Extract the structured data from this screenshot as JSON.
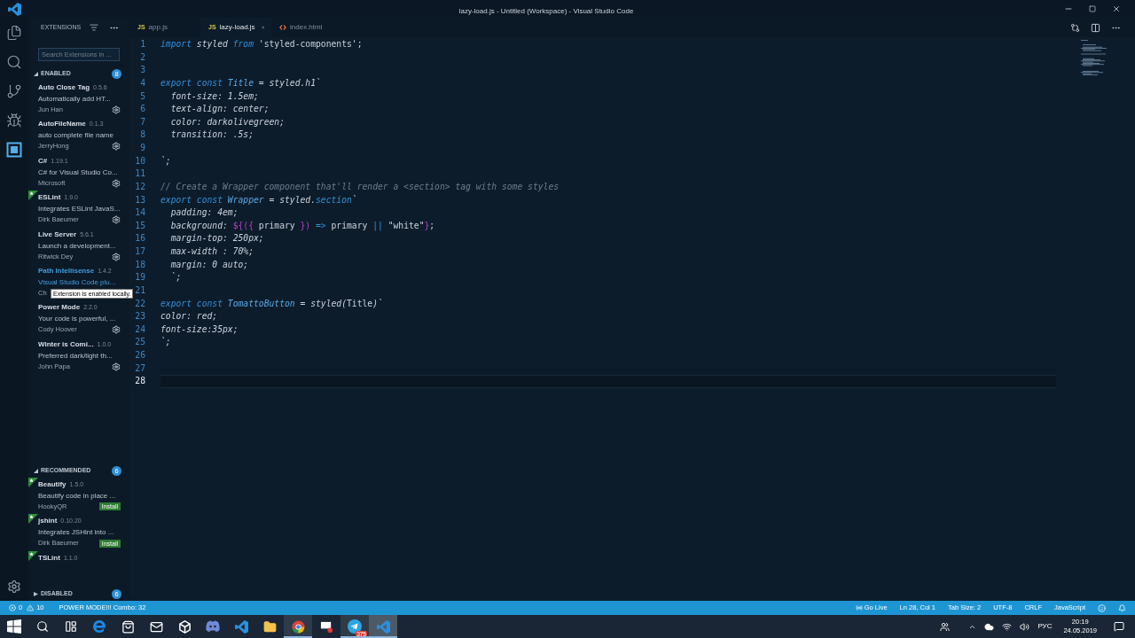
{
  "window": {
    "title": "lazy-load.js - Untitled (Workspace) - Visual Studio Code"
  },
  "activity_bar": [
    {
      "kind": "files",
      "selected": false
    },
    {
      "kind": "search",
      "selected": false
    },
    {
      "kind": "source-control",
      "selected": false
    },
    {
      "kind": "debug",
      "selected": false
    },
    {
      "kind": "extensions",
      "selected": true
    }
  ],
  "sidebar": {
    "title": "EXTENSIONS",
    "search": {
      "placeholder": "Search Extensions in ..."
    },
    "sections": [
      {
        "title": "ENABLED",
        "count": "8",
        "expanded": true,
        "items": [
          {
            "name": "Auto Close Tag",
            "version": "0.5.6",
            "description": "Automatically add HT...",
            "author": "Jun Han",
            "starred": false,
            "selected": false,
            "kind": "gear"
          },
          {
            "name": "AutoFileName",
            "version": "0.1.3",
            "description": "auto complete file name",
            "author": "JerryHong",
            "starred": false,
            "selected": false,
            "kind": "gear"
          },
          {
            "name": "C#",
            "version": "1.19.1",
            "description": "C# for Visual Studio Co...",
            "author": "Microsoft",
            "starred": false,
            "selected": false,
            "kind": "gear"
          },
          {
            "name": "ESLint",
            "version": "1.9.0",
            "description": "Integrates ESLint JavaS...",
            "author": "Dirk Baeumer",
            "starred": true,
            "selected": false,
            "kind": "gear"
          },
          {
            "name": "Live Server",
            "version": "5.6.1",
            "description": "Launch a development...",
            "author": "Ritwick Dey",
            "starred": false,
            "selected": false,
            "kind": "gear"
          },
          {
            "name": "Path Intellisense",
            "version": "1.4.2",
            "description": "Visual Studio Code plu...",
            "author": "Ch",
            "starred": false,
            "selected": true,
            "kind": "plain",
            "tooltip": "Extension is enabled locally."
          },
          {
            "name": "Power Mode",
            "version": "2.2.0",
            "description": "Your code is powerful, ...",
            "author": "Cody Hoover",
            "starred": false,
            "selected": false,
            "kind": "gear"
          },
          {
            "name": "Winter is Comi...",
            "version": "1.0.0",
            "description": "Preferred dark/light th...",
            "author": "John Papa",
            "starred": false,
            "selected": false,
            "kind": "gear"
          }
        ]
      },
      {
        "title": "RECOMMENDED",
        "count": "6",
        "expanded": true,
        "items": [
          {
            "name": "Beautify",
            "version": "1.5.0",
            "description": "Beautify code in place ...",
            "author": "HookyQR",
            "starred": true,
            "selected": false,
            "kind": "install",
            "action_label": "Install"
          },
          {
            "name": "jshint",
            "version": "0.10.20",
            "description": "Integrates JSHint into ...",
            "author": "Dirk Baeumer",
            "starred": true,
            "selected": false,
            "kind": "install",
            "action_label": "Install"
          },
          {
            "name": "TSLint",
            "version": "1.1.0",
            "starred": true,
            "selected": false
          }
        ]
      },
      {
        "title": "DISABLED",
        "count": "6",
        "expanded": false
      }
    ]
  },
  "tabs": [
    {
      "label": "app.js",
      "kind": "js",
      "icon_text": "JS",
      "selected": false
    },
    {
      "label": "lazy-load.js",
      "kind": "js",
      "icon_text": "JS",
      "selected": true
    },
    {
      "label": "index.html",
      "kind": "html",
      "selected": false
    }
  ],
  "editor": {
    "lines": [
      {
        "number": "1",
        "current": false,
        "tokens": [
          {
            "text": "import",
            "kind": "kw"
          },
          {
            "text": " styled ",
            "kind": "id"
          },
          {
            "text": "from",
            "kind": "kw"
          },
          {
            "text": " 'styled-components'",
            "kind": "str"
          },
          {
            "text": ";",
            "kind": "str"
          }
        ]
      },
      {
        "number": "2",
        "current": false
      },
      {
        "number": "3",
        "current": false
      },
      {
        "number": "4",
        "current": false,
        "tokens": [
          {
            "text": "export const",
            "kind": "kw"
          },
          {
            "text": " Title",
            "kind": "ty"
          },
          {
            "text": " = styled.h1`",
            "kind": "id"
          }
        ]
      },
      {
        "number": "5",
        "current": false,
        "tokens": [
          {
            "text": "  font-size: 1.5em;",
            "kind": "id"
          }
        ]
      },
      {
        "number": "6",
        "current": false,
        "tokens": [
          {
            "text": "  text-align: center;",
            "kind": "id"
          }
        ]
      },
      {
        "number": "7",
        "current": false,
        "tokens": [
          {
            "text": "  color: darkolivegreen;",
            "kind": "id"
          }
        ]
      },
      {
        "number": "8",
        "current": false,
        "tokens": [
          {
            "text": "  transition: .5s;",
            "kind": "id"
          }
        ]
      },
      {
        "number": "9",
        "current": false
      },
      {
        "number": "10",
        "current": false,
        "tokens": [
          {
            "text": "`;",
            "kind": "id"
          }
        ]
      },
      {
        "number": "11",
        "current": false
      },
      {
        "number": "12",
        "current": false,
        "tokens": [
          {
            "text": "// Create a Wrapper component that'll render a <section> tag with some styles",
            "kind": "cmt"
          }
        ]
      },
      {
        "number": "13",
        "current": false,
        "tokens": [
          {
            "text": "export const",
            "kind": "kw"
          },
          {
            "text": " Wrapper",
            "kind": "ty"
          },
          {
            "text": " = styled.",
            "kind": "id"
          },
          {
            "text": "section",
            "kind": "kw"
          },
          {
            "text": "`",
            "kind": "id"
          }
        ]
      },
      {
        "number": "14",
        "current": false,
        "tokens": [
          {
            "text": "  padding: 4em;",
            "kind": "id"
          }
        ]
      },
      {
        "number": "15",
        "current": false,
        "tokens": [
          {
            "text": "  background: ",
            "kind": "id"
          },
          {
            "text": "${({",
            "kind": "op"
          },
          {
            "text": " primary ",
            "kind": "str"
          },
          {
            "text": "})",
            "kind": "op"
          },
          {
            "text": " =>",
            "kind": "kw"
          },
          {
            "text": " primary ",
            "kind": "str"
          },
          {
            "text": "||",
            "kind": "kw"
          },
          {
            "text": " \"white\"",
            "kind": "str"
          },
          {
            "text": "}",
            "kind": "op"
          },
          {
            "text": ";",
            "kind": "str"
          }
        ]
      },
      {
        "number": "16",
        "current": false,
        "tokens": [
          {
            "text": "  margin-top: 250px;",
            "kind": "id"
          }
        ]
      },
      {
        "number": "17",
        "current": false,
        "tokens": [
          {
            "text": "  max-width : 70%;",
            "kind": "id"
          }
        ]
      },
      {
        "number": "18",
        "current": false,
        "tokens": [
          {
            "text": "  margin: 0 auto;",
            "kind": "id"
          }
        ]
      },
      {
        "number": "19",
        "current": false,
        "tokens": [
          {
            "text": "  `;",
            "kind": "id"
          }
        ]
      },
      {
        "number": "21",
        "current": false
      },
      {
        "number": "22",
        "current": false,
        "tokens": [
          {
            "text": "export const",
            "kind": "kw"
          },
          {
            "text": " TomattoButton",
            "kind": "ty"
          },
          {
            "text": " = styled(",
            "kind": "id"
          },
          {
            "text": "Title",
            "kind": "str"
          },
          {
            "text": ")`",
            "kind": "id"
          }
        ]
      },
      {
        "number": "23",
        "current": false,
        "tokens": [
          {
            "text": "color: red;",
            "kind": "id"
          }
        ]
      },
      {
        "number": "24",
        "current": false,
        "tokens": [
          {
            "text": "font-size:35px;",
            "kind": "id"
          }
        ]
      },
      {
        "number": "25",
        "current": false,
        "tokens": [
          {
            "text": "`;",
            "kind": "id"
          }
        ]
      },
      {
        "number": "26",
        "current": false
      },
      {
        "number": "27",
        "current": false
      },
      {
        "number": "28",
        "current": true
      }
    ]
  },
  "status_bar": {
    "errors": "0",
    "warnings": "10",
    "power_mode": "POWER MODE!!! Combo: 32",
    "right": [
      {
        "kind": "live",
        "text": "Go Live"
      },
      {
        "kind": "text",
        "text": "Ln 28, Col 1"
      },
      {
        "kind": "text",
        "text": "Tab Size: 2"
      },
      {
        "kind": "text",
        "text": "UTF-8"
      },
      {
        "kind": "text",
        "text": "CRLF"
      },
      {
        "kind": "text",
        "text": "JavaScript"
      },
      {
        "kind": "smiley"
      },
      {
        "kind": "bell"
      }
    ]
  },
  "taskbar": {
    "apps": [
      {
        "kind": "start",
        "open": false,
        "selected": false
      },
      {
        "kind": "search",
        "open": false,
        "selected": false
      },
      {
        "kind": "task-view",
        "open": false,
        "selected": false
      },
      {
        "kind": "edge",
        "open": false,
        "selected": false
      },
      {
        "kind": "store",
        "open": false,
        "selected": false
      },
      {
        "kind": "mail",
        "open": false,
        "selected": false
      },
      {
        "kind": "unity",
        "open": false,
        "selected": false
      },
      {
        "kind": "discord",
        "open": false,
        "selected": false
      },
      {
        "kind": "vscode",
        "open": false,
        "selected": false
      },
      {
        "kind": "folder",
        "open": false,
        "selected": false
      },
      {
        "kind": "chrome",
        "open": true,
        "selected": false
      },
      {
        "kind": "app",
        "open": false,
        "selected": false
      },
      {
        "kind": "telegram",
        "open": true,
        "selected": false,
        "badge": "375"
      },
      {
        "kind": "vscode",
        "open": true,
        "selected": true
      }
    ],
    "tray": {
      "language": "РУС",
      "time": "20:19",
      "date": "24.05.2019"
    }
  }
}
